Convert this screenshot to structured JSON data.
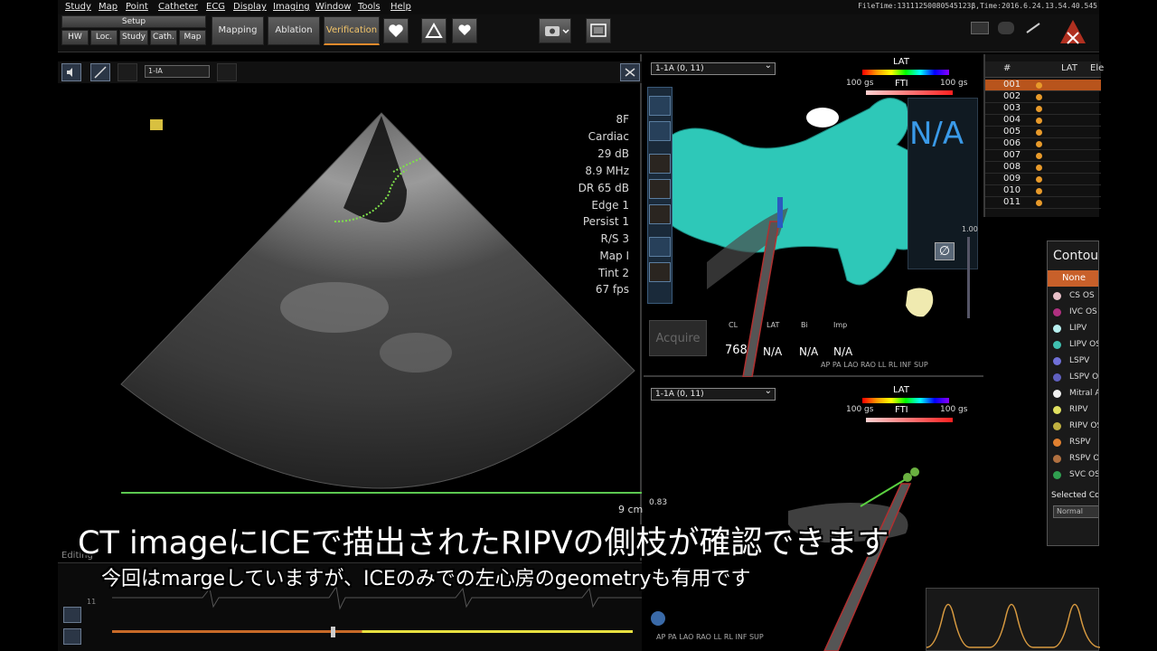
{
  "menu": [
    "Study",
    "Map",
    "Point",
    "Catheter",
    "ECG",
    "Display",
    "Imaging",
    "Window",
    "Tools",
    "Help"
  ],
  "file_info": "FileTime:13111250080545123β,Time:2016.6.24.13.54.40.545",
  "toolbar": {
    "setup_label": "Setup",
    "setup_buttons": [
      "HW",
      "Loc.",
      "Study",
      "Cath.",
      "Map"
    ],
    "modes": [
      "Mapping",
      "Ablation",
      "Verification"
    ],
    "active_mode": "Verification"
  },
  "ice": {
    "select_value": "1-IA",
    "params": [
      "8F",
      "Cardiac",
      "29 dB",
      "8.9 MHz",
      "DR 65 dB",
      "Edge 1",
      "Persist 1",
      "R/S 3",
      "Map I",
      "Tint 2",
      "67 fps"
    ],
    "depth": "9 cm"
  },
  "top_view": {
    "select_value": "1-1A (0, 11)",
    "lat_title": "LAT",
    "gs_left": "100 gs",
    "gs_right": "100 gs",
    "fti": "FTI",
    "na_big": "N/A",
    "scale_value": "1.00",
    "readouts": {
      "labels": [
        "CL",
        "LAT",
        "Bi",
        "Imp"
      ],
      "values": [
        "768",
        "N/A",
        "N/A",
        "N/A"
      ]
    },
    "acquire": "Acquire",
    "view_labels": [
      "AP",
      "PA",
      "LAO",
      "RAO",
      "LL",
      "RL",
      "INF",
      "SUP"
    ]
  },
  "bottom_view": {
    "select_value": "1-1A (0, 11)",
    "lat_title": "LAT",
    "gs_left": "100 gs",
    "gs_right": "100 gs",
    "fti": "FTI",
    "side_value": "0.83",
    "view_labels": [
      "AP",
      "PA",
      "LAO",
      "RAO",
      "LL",
      "RL",
      "INF",
      "SUP"
    ]
  },
  "point_list": {
    "headers": [
      "#",
      "LAT",
      "Ele"
    ],
    "rows": [
      "001",
      "002",
      "003",
      "004",
      "005",
      "006",
      "007",
      "008",
      "009",
      "010",
      "011"
    ],
    "selected_row": "001"
  },
  "contour": {
    "title": "Contou",
    "none_label": "None",
    "items": [
      {
        "label": "CS OS",
        "color": "#e8c0c8"
      },
      {
        "label": "IVC OS",
        "color": "#b03080"
      },
      {
        "label": "LIPV",
        "color": "#b8f0f0"
      },
      {
        "label": "LIPV OS",
        "color": "#40c0b0"
      },
      {
        "label": "LSPV",
        "color": "#7070d8"
      },
      {
        "label": "LSPV O",
        "color": "#6060c0"
      },
      {
        "label": "Mitral A",
        "color": "#f0f0f0"
      },
      {
        "label": "RIPV",
        "color": "#e0e060"
      },
      {
        "label": "RIPV OS",
        "color": "#c0b040"
      },
      {
        "label": "RSPV",
        "color": "#e08030"
      },
      {
        "label": "RSPV O",
        "color": "#b07040"
      },
      {
        "label": "SVC OS",
        "color": "#30a050"
      }
    ],
    "selected_label": "Selected Co",
    "normal_value": "Normal"
  },
  "timeline": {
    "editing_label": "Editing",
    "marker": "11"
  },
  "subtitles": {
    "line1": "CT imageにICEで描出されたRIPVの側枝が確認できます",
    "line2": "今回はmargeしていますが、ICEのみでの左心房のgeometryも有用です"
  }
}
